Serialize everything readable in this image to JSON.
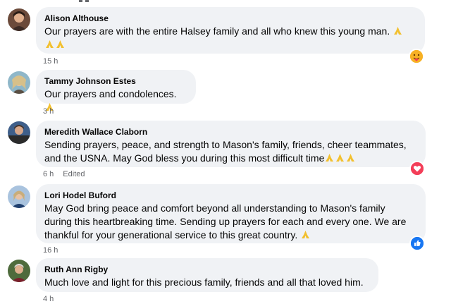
{
  "comments": [
    {
      "name": "Alison Althouse",
      "text_lines": [
        "Our prayers are with the entire Halsey family and all who knew this young man."
      ],
      "emoji_count": 3,
      "time": "15 h",
      "edited": "",
      "reaction": "care-emoji-reaction",
      "reaction_color": "#f7b125"
    },
    {
      "name": "Tammy Johnson Estes",
      "text_lines": [
        "Our prayers and condolences."
      ],
      "emoji_count": 1,
      "time": "3 h",
      "edited": ""
    },
    {
      "name": "Meredith Wallace Claborn",
      "text_lines": [
        "Sending prayers, peace, and strength to Mason's family, friends, cheer teammates,",
        "and the USNA. May God bless you during this most difficult time"
      ],
      "emoji_count": 3,
      "time": "6 h",
      "edited": "Edited",
      "reaction": "love-heart-reaction",
      "reaction_color": "#f33e58"
    },
    {
      "name": "Lori Hodel Buford",
      "text_lines": [
        "May God bring peace and comfort beyond all understanding to Mason's family",
        "during this heartbreaking time. Sending up prayers for each and every one. We are",
        "thankful for your generational service to this great country."
      ],
      "emoji_count": 1,
      "time": "16 h",
      "edited": "",
      "reaction": "like-thumb-reaction",
      "reaction_color": "#1877f2"
    },
    {
      "name": "Ruth Ann Rigby",
      "text_lines": [
        "Much love and light for this precious family, friends and all that loved him."
      ],
      "emoji_count": 0,
      "time": "4 h",
      "edited": ""
    }
  ],
  "colors": {
    "bubble": "#f0f2f5",
    "meta_text": "#65676b",
    "emoji": "#f2c02f"
  }
}
